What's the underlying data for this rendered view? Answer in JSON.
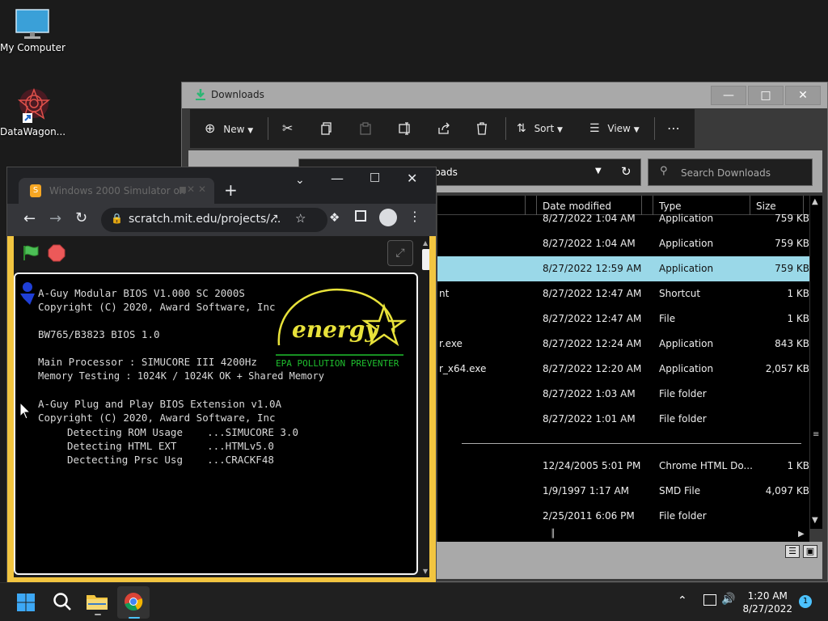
{
  "desktop": {
    "icons": [
      {
        "label": "My Computer"
      },
      {
        "label": "DataWagon..."
      }
    ]
  },
  "explorer": {
    "title": "Downloads",
    "toolbar": {
      "new": "New",
      "sort": "Sort",
      "view": "View"
    },
    "address_partial": "loads",
    "search_placeholder": "Search Downloads",
    "columns": {
      "date": "Date modified",
      "type": "Type",
      "size": "Size"
    },
    "rows": [
      {
        "name": "",
        "date": "8/27/2022 1:04 AM",
        "type": "Application",
        "size": "759 KB"
      },
      {
        "name": "",
        "date": "8/27/2022 1:04 AM",
        "type": "Application",
        "size": "759 KB"
      },
      {
        "name": "",
        "date": "8/27/2022 12:59 AM",
        "type": "Application",
        "size": "759 KB",
        "selected": true
      },
      {
        "name": "nt",
        "date": "8/27/2022 12:47 AM",
        "type": "Shortcut",
        "size": "1 KB"
      },
      {
        "name": "",
        "date": "8/27/2022 12:47 AM",
        "type": "File",
        "size": "1 KB"
      },
      {
        "name": "r.exe",
        "date": "8/27/2022 12:24 AM",
        "type": "Application",
        "size": "843 KB"
      },
      {
        "name": "r_x64.exe",
        "date": "8/27/2022 12:20 AM",
        "type": "Application",
        "size": "2,057 KB"
      },
      {
        "name": "",
        "date": "8/27/2022 1:03 AM",
        "type": "File folder",
        "size": ""
      },
      {
        "name": "",
        "date": "8/27/2022 1:01 AM",
        "type": "File folder",
        "size": ""
      },
      {
        "name": "",
        "date": "12/24/2005 5:01 PM",
        "type": "Chrome HTML Do...",
        "size": "1 KB"
      },
      {
        "name": "",
        "date": "1/9/1997 1:17 AM",
        "type": "SMD File",
        "size": "4,097 KB"
      },
      {
        "name": "",
        "date": "2/25/2011 6:06 PM",
        "type": "File folder",
        "size": ""
      }
    ]
  },
  "chrome": {
    "tab_title": "Windows 2000 Simulator on",
    "url": "scratch.mit.edu/projects/...",
    "bios": {
      "line1": "A-Guy Modular BIOS V1.000 SC 2000S",
      "line2": "Copyright (C) 2020, Award Software, Inc",
      "line3": "BW765/B3823 BIOS 1.0",
      "line4": "Main Processor : SIMUCORE III 4200Hz",
      "line5": "Memory Testing : 1024K / 1024K OK + Shared Memory",
      "line6": "A-Guy Plug and Play BIOS Extension v1.0A",
      "line7": "Copyright (C) 2020, Award Software, Inc",
      "line8": "Detecting ROM Usage    ...SIMUCORE 3.0",
      "line9": "Detecting HTML EXT     ...HTMLv5.0",
      "line10": "Dectecting Prsc Usg    ...CRACKF48",
      "energy_word": "energy",
      "energy_caption": "EPA POLLUTION PREVENTER"
    }
  },
  "taskbar": {
    "time": "1:20 AM",
    "date": "8/27/2022",
    "notifications": "1"
  }
}
